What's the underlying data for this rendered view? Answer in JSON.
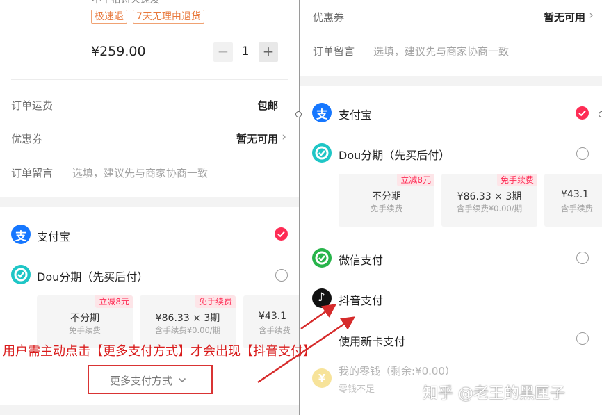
{
  "left": {
    "product": {
      "title_partial": "不千拾诗火速发",
      "tags": [
        "极速退",
        "7天无理由退货"
      ],
      "price": "¥259.00",
      "quantity": "1",
      "minus": "−",
      "plus": "+"
    },
    "rows": {
      "shipping_label": "订单运费",
      "shipping_value": "包邮",
      "coupon_label": "优惠券",
      "coupon_value": "暂无可用",
      "note_label": "订单留言",
      "note_placeholder": "选填，建议先与商家协商一致"
    },
    "payment": {
      "alipay": "支付宝",
      "dou_installment": "Dou分期（先买后付）",
      "cards": [
        {
          "badge": "立减8元",
          "main": "不分期",
          "sub": "免手续费"
        },
        {
          "badge": "免手续费",
          "main": "¥86.33 × 3期",
          "sub": "含手续费¥0.00/期"
        },
        {
          "badge": "",
          "main": "¥43.1",
          "sub": "含手续费"
        }
      ],
      "more_methods": "更多支付方式"
    },
    "annotation": "用户需主动点击【更多支付方式】才会出现【抖音支付】"
  },
  "right": {
    "rows": {
      "coupon_label": "优惠券",
      "coupon_value": "暂无可用",
      "note_label": "订单留言",
      "note_placeholder": "选填，建议先与商家协商一致"
    },
    "payment": {
      "alipay": "支付宝",
      "dou_installment": "Dou分期（先买后付）",
      "cards": [
        {
          "badge": "立减8元",
          "main": "不分期",
          "sub": "免手续费"
        },
        {
          "badge": "免手续费",
          "main": "¥86.33 × 3期",
          "sub": "含手续费¥0.00/期"
        },
        {
          "badge": "",
          "main": "¥43.1",
          "sub": "含手续费"
        }
      ],
      "wechat": "微信支付",
      "douyin": "抖音支付",
      "new_card": "使用新卡支付",
      "change": "我的零钱（剩余:¥0.00）",
      "change_note": "零钱不足"
    }
  },
  "watermark": "知乎 @老王的黑匣子",
  "colors": {
    "selected": "#fe2c55",
    "annotation": "#d91c1c",
    "alipay": "#1677ff",
    "dou": "#1fc6c6",
    "wechat": "#28b44b"
  },
  "icons": {
    "alipay": "alipay-icon",
    "dou": "dou-installment-icon",
    "wechat": "wechat-pay-icon",
    "douyin": "douyin-pay-icon",
    "change": "yuan-coin-icon"
  }
}
